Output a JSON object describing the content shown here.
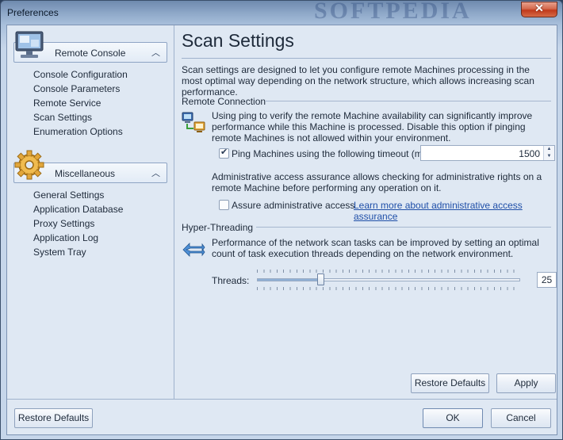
{
  "window": {
    "title": "Preferences",
    "watermark": "SOFTPEDIA",
    "close_glyph": "✕"
  },
  "sidebar": {
    "groups": [
      {
        "title": "Remote Console",
        "icon": "monitor-icon",
        "items": [
          "Console Configuration",
          "Console Parameters",
          "Remote Service",
          "Scan Settings",
          "Enumeration Options"
        ]
      },
      {
        "title": "Miscellaneous",
        "icon": "gear-icon",
        "items": [
          "General Settings",
          "Application Database",
          "Proxy Settings",
          "Application Log",
          "System Tray"
        ]
      }
    ],
    "collapse_glyph": "︿",
    "selected_item": "Scan Settings"
  },
  "main": {
    "title": "Scan Settings",
    "description": "Scan settings are designed to let you configure remote Machines processing in the most optimal way depending on the network structure, which allows increasing scan performance.",
    "remote_connection": {
      "heading": "Remote Connection",
      "icon": "network-computers-icon",
      "ping_text": "Using ping to verify the remote Machine availability can significantly improve performance while this Machine is processed. Disable this option if pinging remote Machines is not allowed within your environment.",
      "ping_checkbox_label": "Ping Machines using the following timeout (ms.):",
      "ping_checked": true,
      "timeout_value": "1500",
      "admin_text": "Administrative access assurance allows checking for administrative rights on a remote Machine before performing any operation on it.",
      "admin_checkbox_label": "Assure administrative access",
      "admin_checked": false,
      "learn_more_link": "Learn more about administrative access assurance"
    },
    "hyper_threading": {
      "heading": "Hyper-Threading",
      "icon": "threads-arrows-icon",
      "text": "Performance of the network scan tasks can be improved by setting an optimal count of task execution threads depending on the network environment.",
      "threads_label": "Threads:",
      "threads_value": "25",
      "threads_fraction": 0.24
    },
    "restore_defaults_label": "Restore Defaults",
    "apply_label": "Apply"
  },
  "footer": {
    "restore_defaults_label": "Restore Defaults",
    "ok_label": "OK",
    "cancel_label": "Cancel"
  }
}
